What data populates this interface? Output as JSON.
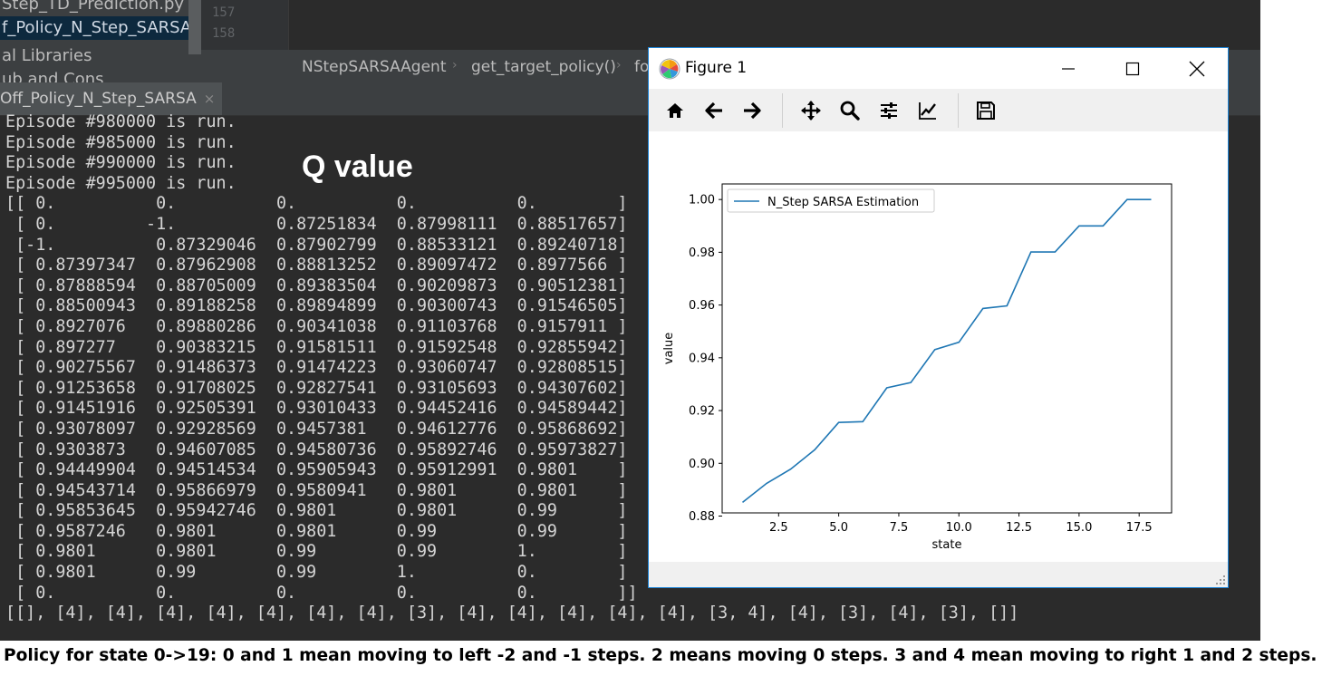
{
  "project_tree": {
    "items": [
      "Step_TD_Prediction.py",
      "f_Policy_N_Step_SARSA.py",
      "al Libraries",
      "ub and Cons"
    ]
  },
  "editor": {
    "line_numbers": [
      "157",
      "158"
    ]
  },
  "breadcrumb": {
    "items": [
      "NStepSARSAAgent",
      "get_target_policy()",
      "fo"
    ]
  },
  "run_panel": {
    "tab_label": "Off_Policy_N_Step_SARSA",
    "tab_close": "×",
    "console_lines": [
      "Episode #980000 is run.",
      "Episode #985000 is run.",
      "Episode #990000 is run.",
      "Episode #995000 is run.",
      "[[ 0.          0.          0.          0.          0.        ]",
      " [ 0.         -1.          0.87251834  0.87998111  0.88517657]",
      " [-1.          0.87329046  0.87902799  0.88533121  0.89240718]",
      " [ 0.87397347  0.87962908  0.88813252  0.89097472  0.8977566 ]",
      " [ 0.87888594  0.88705009  0.89383504  0.90209873  0.90512381]",
      " [ 0.88500943  0.89188258  0.89894899  0.90300743  0.91546505]",
      " [ 0.8927076   0.89880286  0.90341038  0.91103768  0.9157911 ]",
      " [ 0.897277    0.90383215  0.91581511  0.91592548  0.92855942]",
      " [ 0.90275567  0.91486373  0.91474223  0.93060747  0.92808515]",
      " [ 0.91253658  0.91708025  0.92827541  0.93105693  0.94307602]",
      " [ 0.91451916  0.92505391  0.93010433  0.94452416  0.94589442]",
      " [ 0.93078097  0.92928569  0.9457381   0.94612776  0.95868692]",
      " [ 0.9303873   0.94607085  0.94580736  0.95892746  0.95973827]",
      " [ 0.94449904  0.94514534  0.95905943  0.95912991  0.9801    ]",
      " [ 0.94543714  0.95866979  0.9580941   0.9801      0.9801    ]",
      " [ 0.95853645  0.95942746  0.9801      0.9801      0.99      ]",
      " [ 0.9587246   0.9801      0.9801      0.99        0.99      ]",
      " [ 0.9801      0.9801      0.99        0.99        1.        ]",
      " [ 0.9801      0.99        0.99        1.          0.        ]",
      " [ 0.          0.          0.          0.          0.        ]]",
      "[[], [4], [4], [4], [4], [4], [4], [4], [3], [4], [4], [4], [4], [4], [3, 4], [4], [3], [4], [3], []]"
    ]
  },
  "annotation": {
    "q_value_heading": "Q value"
  },
  "caption": "Policy for state 0->19: 0 and 1 mean moving to left -2 and -1 steps. 2 means moving 0 steps. 3 and 4 mean moving to right 1 and 2 steps.",
  "figure_window": {
    "title": "Figure 1",
    "toolbar_icons": [
      "home-icon",
      "back-arrow-icon",
      "forward-arrow-icon",
      "pan-icon",
      "zoom-icon",
      "subplots-config-icon",
      "edit-axis-icon",
      "save-icon"
    ]
  },
  "chart_data": {
    "type": "line",
    "xlabel": "state",
    "ylabel": "value",
    "xlim": [
      0.15,
      18.85
    ],
    "ylim": [
      0.8812,
      1.0059
    ],
    "x_ticks": [
      2.5,
      5.0,
      7.5,
      10.0,
      12.5,
      15.0,
      17.5
    ],
    "x_tick_labels": [
      "2.5",
      "5.0",
      "7.5",
      "10.0",
      "12.5",
      "15.0",
      "17.5"
    ],
    "y_ticks": [
      0.88,
      0.9,
      0.92,
      0.94,
      0.96,
      0.98,
      1.0
    ],
    "y_tick_labels": [
      "0.88",
      "0.90",
      "0.92",
      "0.94",
      "0.96",
      "0.98",
      "1.00"
    ],
    "legend_position": "upper-left",
    "color": "#1f77b4",
    "series": [
      {
        "name": "N_Step SARSA Estimation",
        "x": [
          1,
          2,
          3,
          4,
          5,
          6,
          7,
          8,
          9,
          10,
          11,
          12,
          13,
          14,
          15,
          16,
          17,
          18
        ],
        "values": [
          0.8852,
          0.8924,
          0.8978,
          0.9051,
          0.9155,
          0.9158,
          0.9286,
          0.9306,
          0.9431,
          0.9459,
          0.9587,
          0.9597,
          0.9801,
          0.9801,
          0.99,
          0.99,
          1.0,
          1.0
        ]
      }
    ]
  }
}
